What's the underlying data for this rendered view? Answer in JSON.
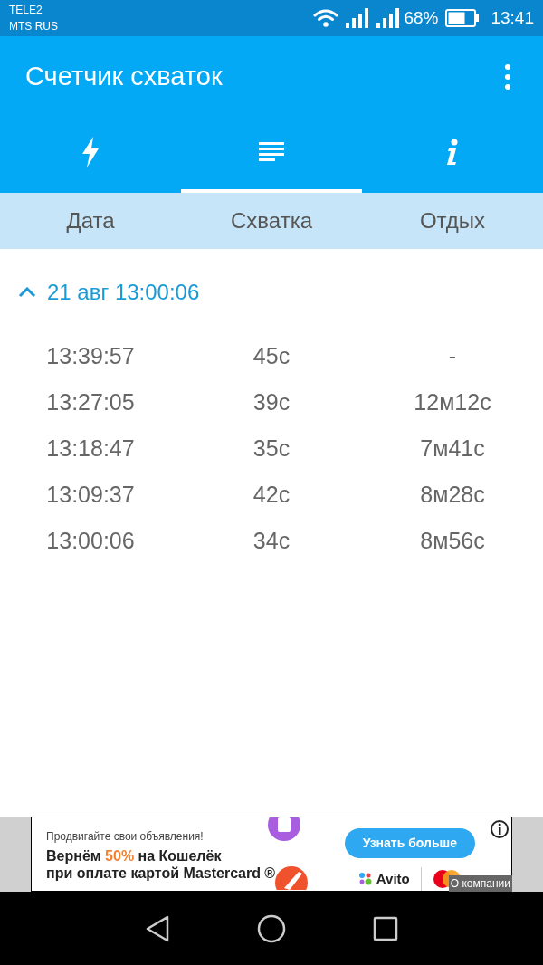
{
  "status_bar": {
    "carriers": [
      "TELE2",
      "MTS RUS"
    ],
    "battery": "68%",
    "time": "13:41"
  },
  "app_bar": {
    "title": "Счетчик схваток"
  },
  "tabs": [
    {
      "kind": "bolt",
      "selected": false
    },
    {
      "kind": "list",
      "selected": true
    },
    {
      "kind": "info",
      "selected": false
    }
  ],
  "columns": [
    "Дата",
    "Схватка",
    "Отдых"
  ],
  "groups": [
    {
      "title": "21 авг 13:00:06",
      "expanded": true,
      "rows": [
        {
          "date": "13:39:57",
          "contraction": "45с",
          "rest": "-"
        },
        {
          "date": "13:27:05",
          "contraction": "39с",
          "rest": "12м12с"
        },
        {
          "date": "13:18:47",
          "contraction": "35с",
          "rest": "7м41с"
        },
        {
          "date": "13:09:37",
          "contraction": "42с",
          "rest": "8м28с"
        },
        {
          "date": "13:00:06",
          "contraction": "34с",
          "rest": "8м56с"
        }
      ]
    }
  ],
  "ad": {
    "tagline": "Продвигайте свои объявления!",
    "headline": [
      {
        "text": "Вернём ",
        "accent": false
      },
      {
        "text": "50%",
        "accent": true
      },
      {
        "text": " на Кошелёк",
        "accent": false
      }
    ],
    "subline": "при оплате картой Mastercard ®",
    "button": "Узнать больше",
    "brand": "Avito",
    "about": "О компании"
  }
}
